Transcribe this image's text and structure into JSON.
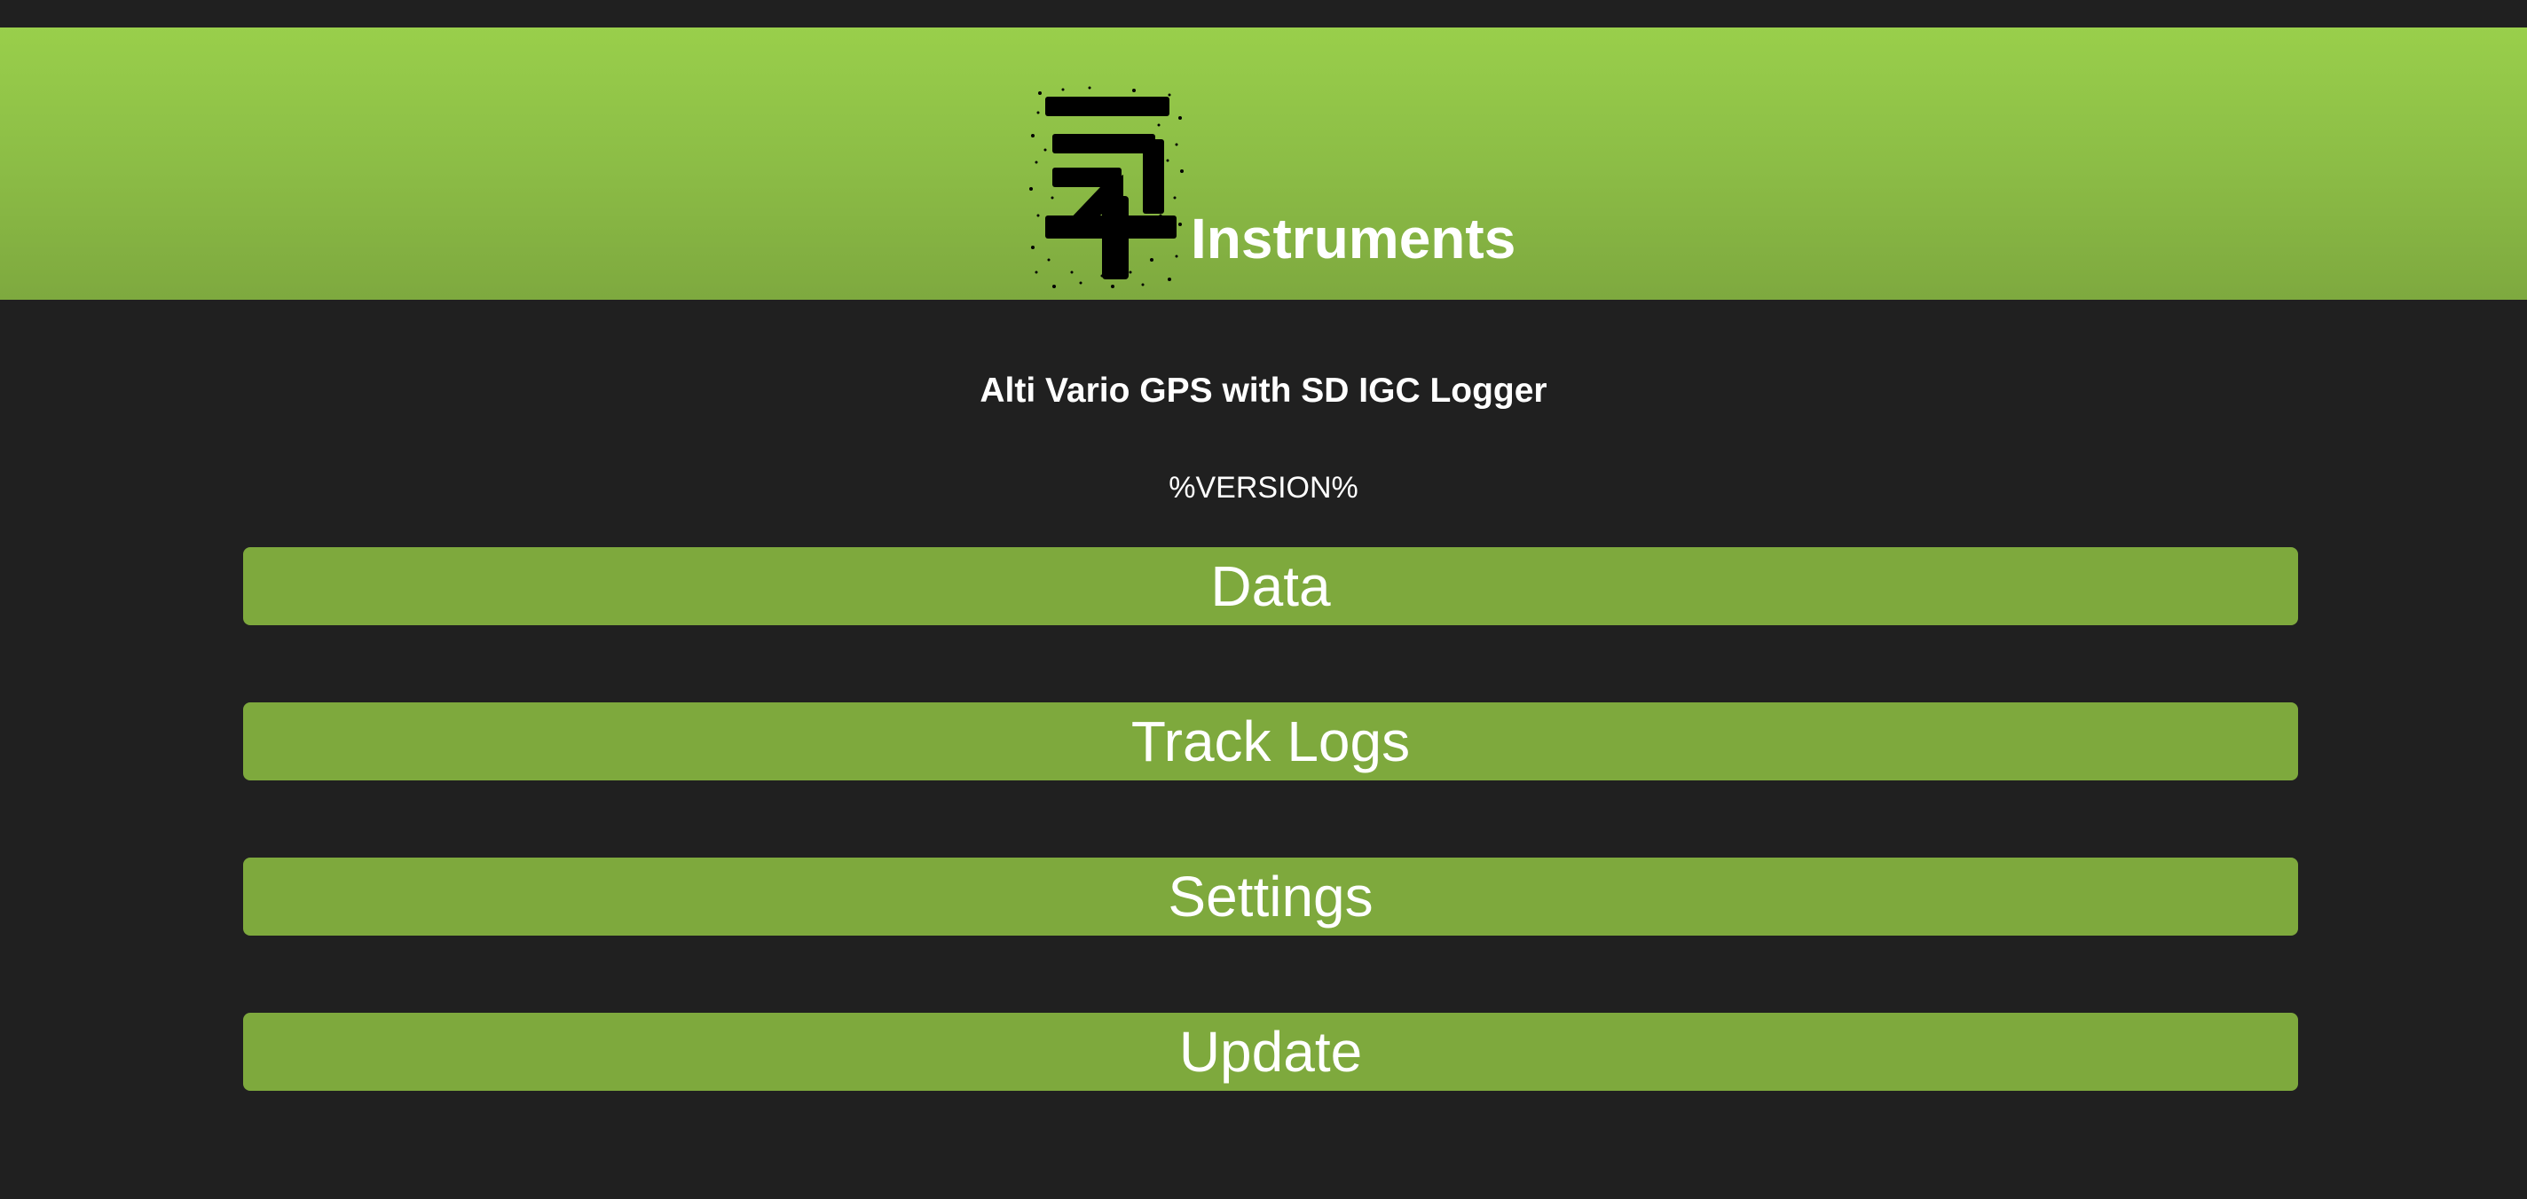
{
  "header": {
    "brand_name": "Instruments",
    "logo_icon": "stylized-glyph-logo-icon",
    "background_color": "#8fc348"
  },
  "subtitle": "Alti Vario GPS with SD IGC Logger",
  "version": "%VERSION%",
  "menu": {
    "items": [
      {
        "label": "Data"
      },
      {
        "label": "Track Logs"
      },
      {
        "label": "Settings"
      },
      {
        "label": "Update"
      }
    ],
    "button_color": "#7ea93d"
  },
  "page_background": "#202020"
}
